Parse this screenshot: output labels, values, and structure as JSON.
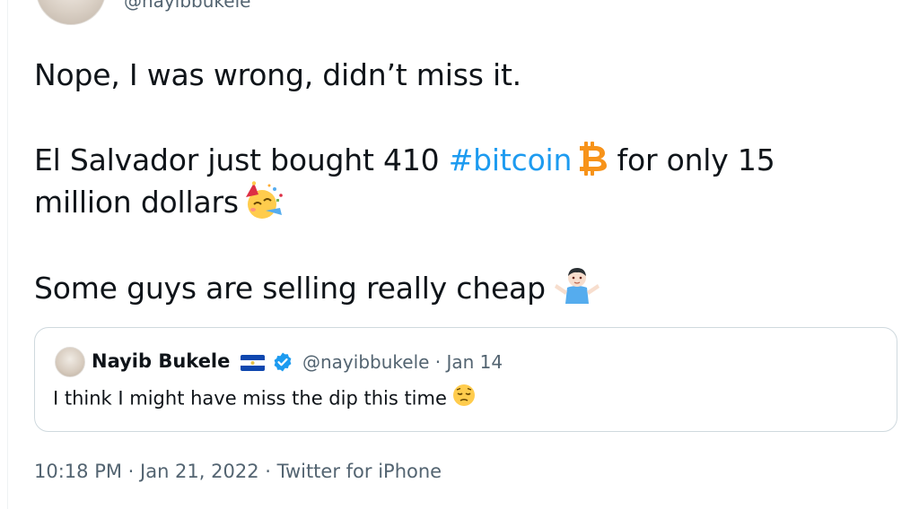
{
  "author": {
    "handle": "@nayibbukele"
  },
  "tweet": {
    "line1": "Nope, I was wrong, didn’t miss it.",
    "line2_prefix": "El Salvador just bought 410 ",
    "line2_hashtag": "#bitcoin",
    "line2_suffix": " for only 15",
    "line3": "million dollars",
    "line4": "Some guys are selling really cheap",
    "emojis": [
      "bitcoin-icon",
      "partying-face-emoji",
      "shrugging-person-emoji"
    ]
  },
  "quoted_tweet": {
    "name": "Nayib Bukele",
    "meta": "@nayibbukele · Jan 14",
    "text": "I think I might have miss the dip this time",
    "icons": [
      "el-salvador-flag-icon",
      "verified-badge-icon",
      "pensive-face-emoji"
    ]
  },
  "footer": {
    "timestamp": "10:18 PM · Jan 21, 2022 · Twitter for iPhone"
  },
  "colors": {
    "text": "#0f1419",
    "secondary": "#536471",
    "link": "#1d9bf0",
    "border": "#cfd9de",
    "bitcoin": "#f7931a"
  }
}
